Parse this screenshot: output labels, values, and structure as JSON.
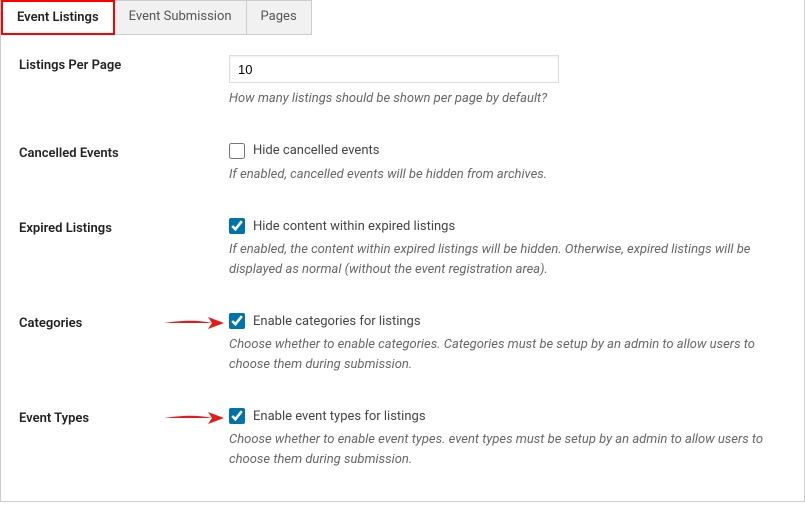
{
  "tabs": {
    "event_listings": "Event Listings",
    "event_submission": "Event Submission",
    "pages": "Pages"
  },
  "settings": {
    "listings_per_page": {
      "label": "Listings Per Page",
      "value": "10",
      "description": "How many listings should be shown per page by default?"
    },
    "cancelled_events": {
      "label": "Cancelled Events",
      "checkbox_label": "Hide cancelled events",
      "checked": false,
      "description": "If enabled, cancelled events will be hidden from archives."
    },
    "expired_listings": {
      "label": "Expired Listings",
      "checkbox_label": "Hide content within expired listings",
      "checked": true,
      "description": "If enabled, the content within expired listings will be hidden. Otherwise, expired listings will be displayed as normal (without the event registration area)."
    },
    "categories": {
      "label": "Categories",
      "checkbox_label": "Enable categories for listings",
      "checked": true,
      "description": "Choose whether to enable categories. Categories must be setup by an admin to allow users to choose them during submission."
    },
    "event_types": {
      "label": "Event Types",
      "checkbox_label": "Enable event types for listings",
      "checked": true,
      "description": "Choose whether to enable event types. event types must be setup by an admin to allow users to choose them during submission."
    }
  }
}
